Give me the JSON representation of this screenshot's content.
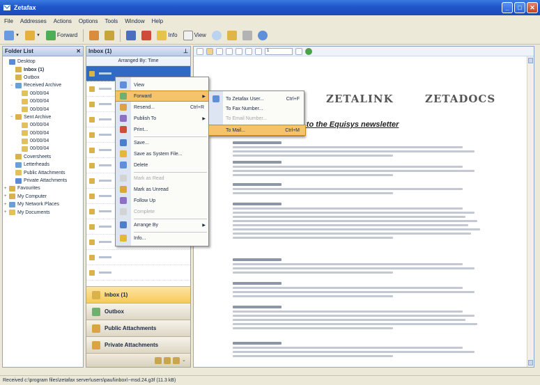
{
  "window": {
    "title": "Zetafax"
  },
  "menubar": [
    "File",
    "Addresses",
    "Actions",
    "Options",
    "Tools",
    "Window",
    "Help"
  ],
  "toolbar": {
    "new_label": "Forward",
    "info_label": "Info",
    "view_label": "View"
  },
  "folders": {
    "header": "Folder List",
    "close_glyph": "✕",
    "items": [
      {
        "label": "Desktop",
        "depth": 0,
        "exp": ""
      },
      {
        "label": "Inbox (1)",
        "depth": 1,
        "exp": ""
      },
      {
        "label": "Outbox",
        "depth": 1,
        "exp": ""
      },
      {
        "label": "Received Archive",
        "depth": 1,
        "exp": "−"
      },
      {
        "label": "00/00/04",
        "depth": 2,
        "exp": ""
      },
      {
        "label": "00/00/04",
        "depth": 2,
        "exp": ""
      },
      {
        "label": "00/00/04",
        "depth": 2,
        "exp": ""
      },
      {
        "label": "Sent Archive",
        "depth": 1,
        "exp": "−"
      },
      {
        "label": "00/00/04",
        "depth": 2,
        "exp": ""
      },
      {
        "label": "00/00/04",
        "depth": 2,
        "exp": ""
      },
      {
        "label": "00/00/04",
        "depth": 2,
        "exp": ""
      },
      {
        "label": "00/00/04",
        "depth": 2,
        "exp": ""
      },
      {
        "label": "Coversheets",
        "depth": 1,
        "exp": ""
      },
      {
        "label": "Letterheads",
        "depth": 1,
        "exp": ""
      },
      {
        "label": "Public Attachments",
        "depth": 1,
        "exp": ""
      },
      {
        "label": "Private Attachments",
        "depth": 1,
        "exp": ""
      },
      {
        "label": "Favourites",
        "depth": 0,
        "exp": "+"
      },
      {
        "label": "My Computer",
        "depth": 0,
        "exp": "+"
      },
      {
        "label": "My Network Places",
        "depth": 0,
        "exp": "+"
      },
      {
        "label": "My Documents",
        "depth": 0,
        "exp": "+"
      }
    ]
  },
  "list": {
    "header": "Inbox (1)",
    "arrange_label": "Arranged By: Time",
    "navbuttons": [
      "Inbox (1)",
      "Outbox",
      "Public Attachments",
      "Private Attachments"
    ]
  },
  "reading": {
    "zoom_value": "1",
    "logos": {
      "second": "ZETALINK",
      "third": "ZETADOCS"
    },
    "headline": "come to the Equisys newsletter"
  },
  "status": {
    "text": "Received c:\\program files\\zetafax server\\users\\paul\\inbox\\~msd.24.g3f (11.3 kB)"
  },
  "context_menu": {
    "items": [
      {
        "label": "View",
        "shortcut": "",
        "arrow": false,
        "highlight": false,
        "disabled": false,
        "sep_before": false
      },
      {
        "label": "Forward",
        "shortcut": "",
        "arrow": true,
        "highlight": true,
        "disabled": false,
        "sep_before": false
      },
      {
        "label": "Resend...",
        "shortcut": "Ctrl+R",
        "arrow": false,
        "highlight": false,
        "disabled": false,
        "sep_before": false
      },
      {
        "label": "Publish To",
        "shortcut": "",
        "arrow": true,
        "highlight": false,
        "disabled": false,
        "sep_before": false
      },
      {
        "label": "Print...",
        "shortcut": "",
        "arrow": false,
        "highlight": false,
        "disabled": false,
        "sep_before": false
      },
      {
        "label": "Save...",
        "shortcut": "",
        "arrow": false,
        "highlight": false,
        "disabled": false,
        "sep_before": true
      },
      {
        "label": "Save as System File...",
        "shortcut": "",
        "arrow": false,
        "highlight": false,
        "disabled": false,
        "sep_before": false
      },
      {
        "label": "Delete",
        "shortcut": "",
        "arrow": false,
        "highlight": false,
        "disabled": false,
        "sep_before": false
      },
      {
        "label": "Mark as Read",
        "shortcut": "",
        "arrow": false,
        "highlight": false,
        "disabled": true,
        "sep_before": true
      },
      {
        "label": "Mark as Unread",
        "shortcut": "",
        "arrow": false,
        "highlight": false,
        "disabled": false,
        "sep_before": false
      },
      {
        "label": "Follow Up",
        "shortcut": "",
        "arrow": false,
        "highlight": false,
        "disabled": false,
        "sep_before": false
      },
      {
        "label": "Complete",
        "shortcut": "",
        "arrow": false,
        "highlight": false,
        "disabled": true,
        "sep_before": false
      },
      {
        "label": "Arrange By",
        "shortcut": "",
        "arrow": true,
        "highlight": false,
        "disabled": false,
        "sep_before": true
      },
      {
        "label": "Info...",
        "shortcut": "",
        "arrow": false,
        "highlight": false,
        "disabled": false,
        "sep_before": true
      }
    ]
  },
  "submenu": {
    "items": [
      {
        "label": "To Zetafax User...",
        "shortcut": "Ctrl+F",
        "highlight": false,
        "disabled": false
      },
      {
        "label": "To Fax Number...",
        "shortcut": "",
        "highlight": false,
        "disabled": false
      },
      {
        "label": "To Email Number...",
        "shortcut": "",
        "highlight": false,
        "disabled": true
      },
      {
        "label": "To Mail...",
        "shortcut": "Ctrl+M",
        "highlight": true,
        "disabled": false
      }
    ]
  },
  "colors": {
    "titlebar": "#1f56c9",
    "highlight": "#f4c36a",
    "selection": "#316ac5",
    "nav_active": "#f7c95a"
  }
}
